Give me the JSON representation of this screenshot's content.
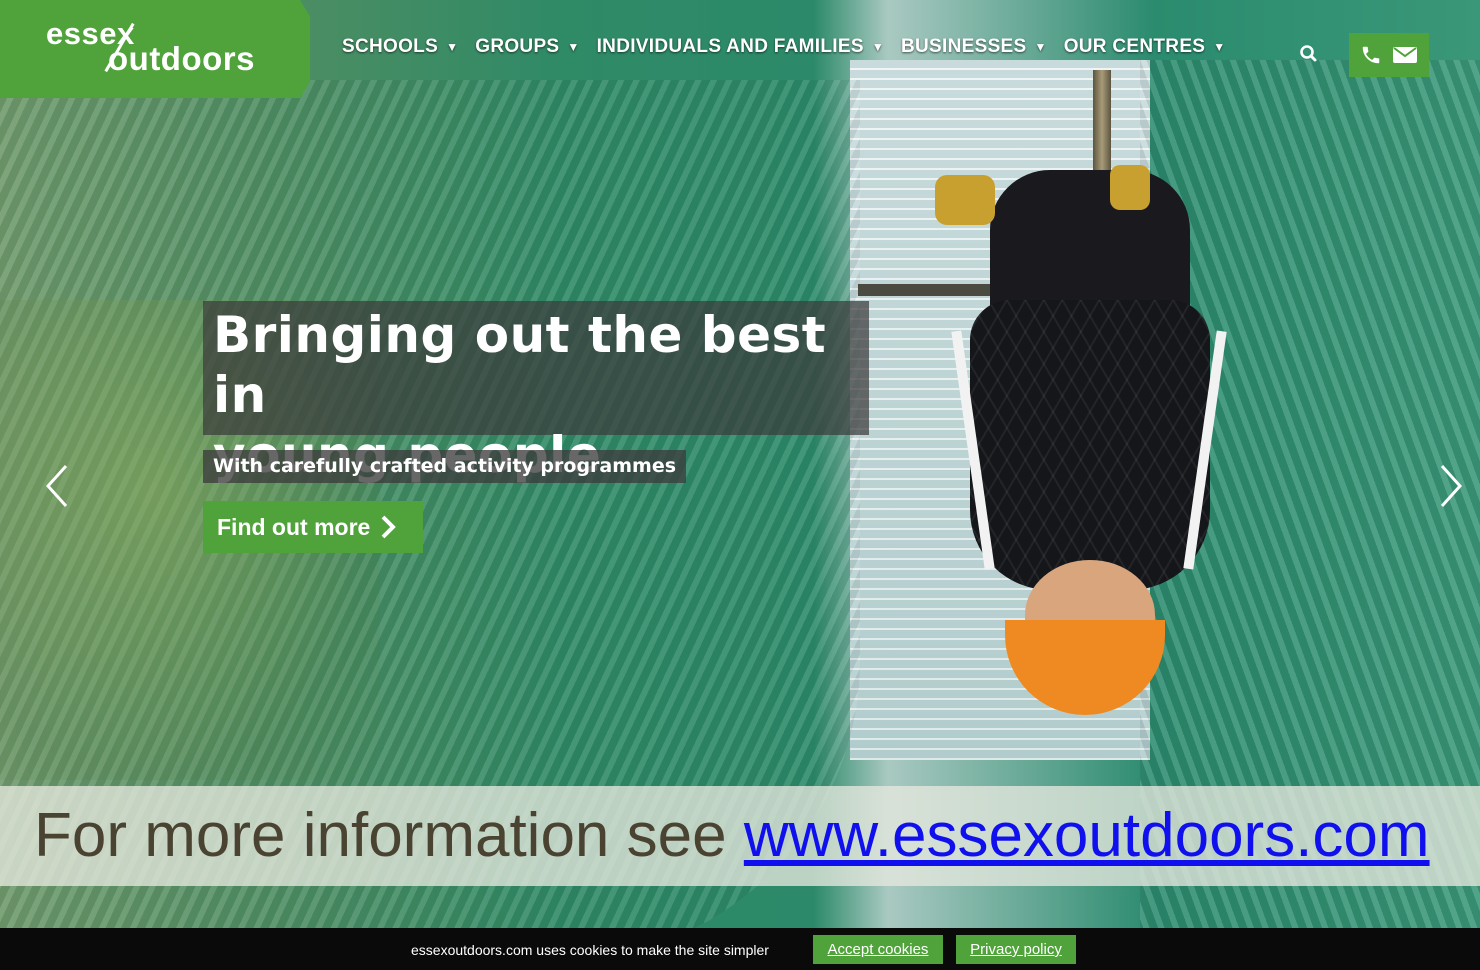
{
  "logo": {
    "top": "essex",
    "bottom": "outdoors"
  },
  "nav": [
    {
      "label": "SCHOOLS"
    },
    {
      "label": "GROUPS"
    },
    {
      "label": "INDIVIDUALS AND FAMILIES"
    },
    {
      "label": "BUSINESSES"
    },
    {
      "label": "OUR CENTRES"
    }
  ],
  "hero": {
    "headline_line1": "Bringing out the best in",
    "headline_line2": "young people",
    "subheading": "With carefully crafted activity programmes",
    "cta_label": "Find out more"
  },
  "info": {
    "prefix": "For more information see ",
    "link": "www.essexoutdoors.com"
  },
  "cookie": {
    "text": "essexoutdoors.com uses cookies to make the site simpler",
    "accept": "Accept cookies",
    "privacy": "Privacy policy"
  },
  "colors": {
    "brand_green": "#4fa33a",
    "cookie_bar": "#0a0a0a",
    "link_blue": "#1010ee"
  },
  "icons": [
    "search-icon",
    "phone-icon",
    "envelope-icon",
    "chevron-left-icon",
    "chevron-right-icon",
    "chevron-right-cta-icon"
  ]
}
